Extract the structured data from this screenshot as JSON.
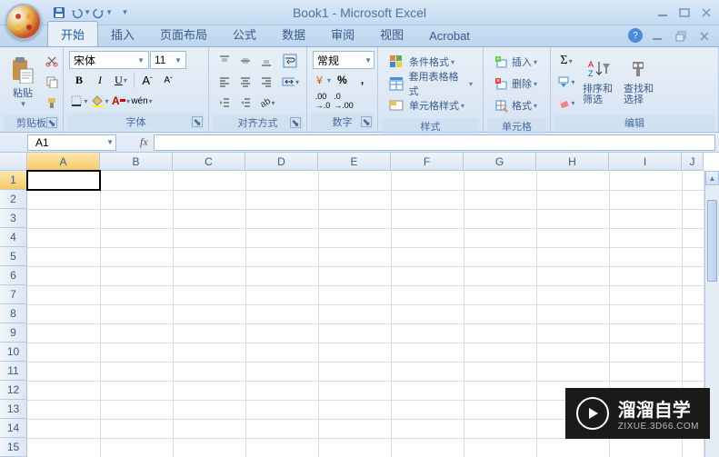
{
  "title": "Book1 - Microsoft Excel",
  "tabs": [
    "开始",
    "插入",
    "页面布局",
    "公式",
    "数据",
    "审阅",
    "视图",
    "Acrobat"
  ],
  "active_tab": 0,
  "ribbon": {
    "clipboard": {
      "label": "剪贴板",
      "paste": "粘贴"
    },
    "font": {
      "label": "字体",
      "name": "宋体",
      "size": "11"
    },
    "alignment": {
      "label": "对齐方式"
    },
    "number": {
      "label": "数字",
      "format": "常规"
    },
    "styles": {
      "label": "样式",
      "cond": "条件格式",
      "table": "套用表格格式",
      "cell": "单元格样式"
    },
    "cells": {
      "label": "单元格",
      "insert": "插入",
      "delete": "删除",
      "format": "格式"
    },
    "editing": {
      "label": "编辑",
      "sort": "排序和\n筛选",
      "find": "查找和\n选择"
    }
  },
  "name_box": "A1",
  "formula_bar": "",
  "columns": [
    "A",
    "B",
    "C",
    "D",
    "E",
    "F",
    "G",
    "H",
    "I",
    "J"
  ],
  "rows": [
    1,
    2,
    3,
    4,
    5,
    6,
    7,
    8,
    9,
    10,
    11,
    12,
    13,
    14,
    15
  ],
  "active_cell": "A1",
  "watermark": {
    "main": "溜溜自学",
    "sub": "ZIXUE.3D66.COM"
  }
}
